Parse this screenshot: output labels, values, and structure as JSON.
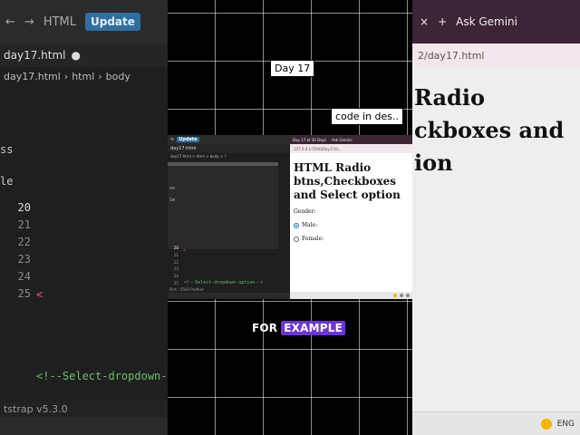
{
  "overlays": {
    "day_label": "Day 17",
    "note_label": "code in des..",
    "caption_plain": "FOR",
    "caption_highlight": "EXAMPLE"
  },
  "bg_editor": {
    "update_label": "Update",
    "html_label": "HTML",
    "file_tab": "day17.html",
    "breadcrumb": [
      "day17.html",
      "html",
      "body"
    ],
    "code_fragments": [
      "ss",
      "le"
    ],
    "line_numbers": [
      "20",
      "21",
      "22",
      "23",
      "24",
      "25"
    ],
    "code_line": "<!--Select-dropdown-",
    "status_text": "tstrap v5.3.0"
  },
  "bg_browser": {
    "address": "2/day17.html",
    "ask_label": "Ask Gemini",
    "page_text_lines": [
      "Radio",
      "ckboxes and",
      "ion"
    ],
    "taskbar_text": "ENG"
  },
  "screen": {
    "editor": {
      "update_label": "Update",
      "file_tab": "day17.html",
      "breadcrumb": "day17.html > html > body > ?",
      "line_numbers": [
        "20",
        "21",
        "22",
        "23",
        "24",
        "25"
      ],
      "comment_line": "<!--Select-dropdown-option-->",
      "status": "Port : 5500   Prettier"
    },
    "browser": {
      "tab_title": "Day 17 of 30 Days",
      "ask_label": "Ask Gemini",
      "address": "127.0.0.1:5500/Day17/d...",
      "page_heading": "HTML Radio btns,Checkboxes and Select option",
      "gender_label": "Gender:",
      "options": [
        {
          "label": "Male:",
          "checked": true
        },
        {
          "label": "Female:",
          "checked": false
        }
      ]
    }
  },
  "colors": {
    "highlight": "#6d35d6",
    "update_button": "#2f6f9f",
    "browser_tabbar": "#3b2636"
  }
}
